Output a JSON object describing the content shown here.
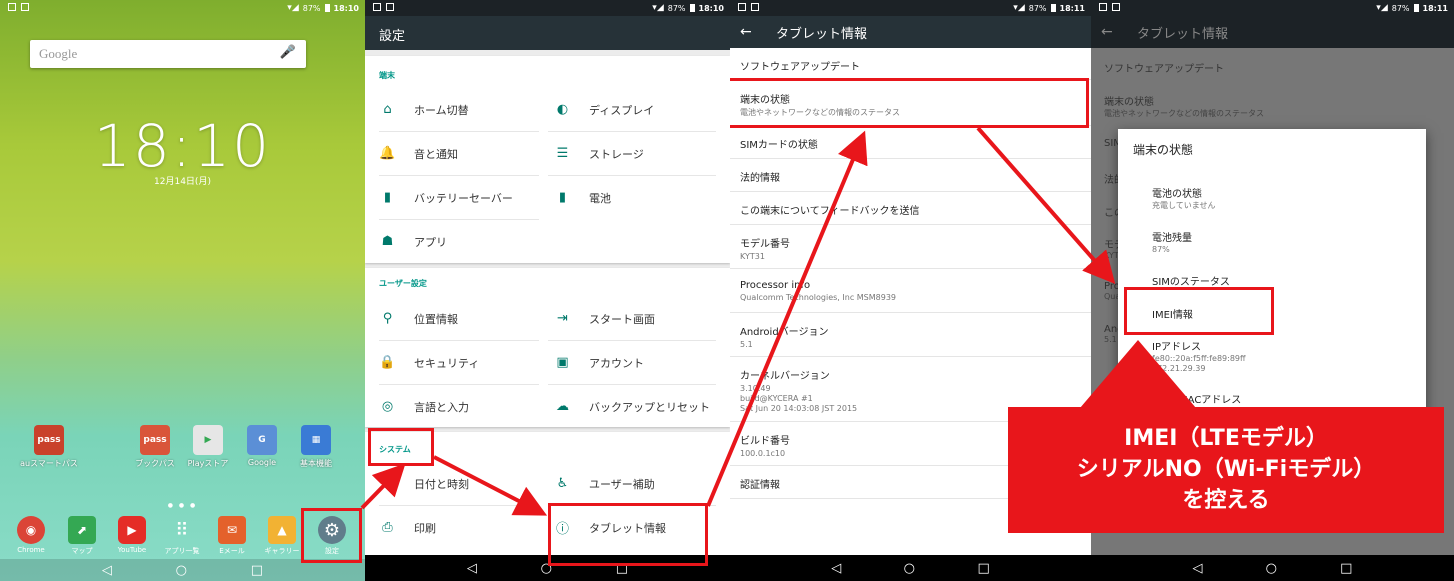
{
  "status": {
    "battery": "87%",
    "time_p1": "18:10",
    "time_p2": "18:10",
    "time_p3": "18:11",
    "time_p4": "18:11"
  },
  "home": {
    "search_label": "Google",
    "clock": "18:10",
    "date": "12月14日(月)",
    "apps": [
      {
        "label": "auスマートパス",
        "icon": "pass-icon",
        "color": "#c9412b",
        "glyph": "pass"
      },
      {
        "label": "ブックパス",
        "icon": "bookpass-icon",
        "color": "#d9553a",
        "glyph": "pass"
      },
      {
        "label": "Playストア",
        "icon": "play-store-icon",
        "color": "#e6e6e6",
        "glyph": "▶"
      },
      {
        "label": "Google",
        "icon": "google-folder-icon",
        "color": "#5b8fd6",
        "glyph": "G"
      },
      {
        "label": "基本機能",
        "icon": "basic-folder-icon",
        "color": "#3a7bd5",
        "glyph": "▦"
      }
    ],
    "dock": [
      {
        "label": "Chrome",
        "icon": "chrome-icon",
        "color": "#db4437",
        "glyph": "◉"
      },
      {
        "label": "マップ",
        "icon": "maps-icon",
        "color": "#34a853",
        "glyph": "⬈"
      },
      {
        "label": "YouTube",
        "icon": "youtube-icon",
        "color": "#e52d27",
        "glyph": "▶"
      },
      {
        "label": "アプリ一覧",
        "icon": "app-drawer-icon",
        "color": "#9ab",
        "glyph": "⠿"
      },
      {
        "label": "Eメール",
        "icon": "email-icon",
        "color": "#e4612b",
        "glyph": "✉"
      },
      {
        "label": "ギャラリー",
        "icon": "gallery-icon",
        "color": "#f2b233",
        "glyph": "▲"
      },
      {
        "label": "設定",
        "icon": "settings-icon",
        "color": "#607d8b",
        "glyph": "⚙"
      }
    ]
  },
  "settings": {
    "title": "設定",
    "sections": [
      {
        "header": "端末",
        "items": [
          {
            "label": "ホーム切替",
            "icon": "home-icon",
            "glyph": "⌂"
          },
          {
            "label": "ディスプレイ",
            "icon": "brightness-icon",
            "glyph": "◐"
          },
          {
            "label": "音と通知",
            "icon": "bell-icon",
            "glyph": "🔔"
          },
          {
            "label": "ストレージ",
            "icon": "storage-icon",
            "glyph": "☰"
          },
          {
            "label": "バッテリーセーバー",
            "icon": "battery-saver-icon",
            "glyph": "▮"
          },
          {
            "label": "電池",
            "icon": "battery-icon",
            "glyph": "▮"
          },
          {
            "label": "アプリ",
            "icon": "android-icon",
            "glyph": "☗"
          }
        ]
      },
      {
        "header": "ユーザー設定",
        "items": [
          {
            "label": "位置情報",
            "icon": "location-icon",
            "glyph": "⚲"
          },
          {
            "label": "スタート画面",
            "icon": "start-screen-icon",
            "glyph": "⇥"
          },
          {
            "label": "セキュリティ",
            "icon": "lock-icon",
            "glyph": "🔒"
          },
          {
            "label": "アカウント",
            "icon": "account-icon",
            "glyph": "▣"
          },
          {
            "label": "言語と入力",
            "icon": "globe-icon",
            "glyph": "◎"
          },
          {
            "label": "バックアップとリセット",
            "icon": "cloud-upload-icon",
            "glyph": "☁"
          }
        ]
      },
      {
        "header": "システム",
        "items": [
          {
            "label": "日付と時刻",
            "icon": "clock-icon",
            "glyph": "◷"
          },
          {
            "label": "ユーザー補助",
            "icon": "accessibility-icon",
            "glyph": "♿"
          },
          {
            "label": "印刷",
            "icon": "print-icon",
            "glyph": "⎙"
          },
          {
            "label": "タブレット情報",
            "icon": "info-icon",
            "glyph": "ⓘ"
          }
        ]
      }
    ]
  },
  "about": {
    "title": "タブレット情報",
    "rows": [
      {
        "title": "ソフトウェアアップデート",
        "sub": ""
      },
      {
        "title": "端末の状態",
        "sub": "電池やネットワークなどの情報のステータス"
      },
      {
        "title": "SIMカードの状態",
        "sub": ""
      },
      {
        "title": "法的情報",
        "sub": ""
      },
      {
        "title": "この端末についてフィードバックを送信",
        "sub": ""
      },
      {
        "title": "モデル番号",
        "sub": "KYT31"
      },
      {
        "title": "Processor info",
        "sub": "Qualcomm Technologies, Inc MSM8939"
      },
      {
        "title": "Androidバージョン",
        "sub": "5.1"
      },
      {
        "title": "カーネルバージョン",
        "sub": "3.10.49\nbuild@KYCERA #1\nSat Jun 20 14:03:08 JST 2015"
      },
      {
        "title": "ビルド番号",
        "sub": "100.0.1c10"
      },
      {
        "title": "認証情報",
        "sub": ""
      }
    ]
  },
  "status_dialog": {
    "title": "端末の状態",
    "items": [
      {
        "title": "電池の状態",
        "sub": "充電していません"
      },
      {
        "title": "電池残量",
        "sub": "87%"
      },
      {
        "title": "SIMのステータス",
        "sub": ""
      },
      {
        "title": "IMEI情報",
        "sub": ""
      },
      {
        "title": "IPアドレス",
        "sub": "fe80::20a:f5ff:fe89:89ff\n172.21.29.39"
      },
      {
        "title": "Wi-Fi MACアドレス",
        "sub": ""
      }
    ]
  },
  "background_rows": [
    {
      "title": "ソフトウェアアップデート",
      "sub": ""
    },
    {
      "title": "端末の状態",
      "sub": "電池やネットワークなどの情報のステータス"
    },
    {
      "title": "SIM",
      "sub": ""
    },
    {
      "title": "法的",
      "sub": ""
    },
    {
      "title": "この",
      "sub": ""
    },
    {
      "title": "モデ",
      "sub": "KYT"
    },
    {
      "title": "Pro",
      "sub": "Qua"
    },
    {
      "title": "And",
      "sub": "5.1"
    }
  ],
  "callout": {
    "line1": "IMEI（LTEモデル）",
    "line2": "シリアルNO（Wi-Fiモデル）",
    "line3": "を控える"
  },
  "nav": {
    "back": "◁",
    "home": "○",
    "recent": "□"
  },
  "colors": {
    "accent": "#e8161b",
    "teal": "#009688",
    "toolbar": "#263238"
  }
}
